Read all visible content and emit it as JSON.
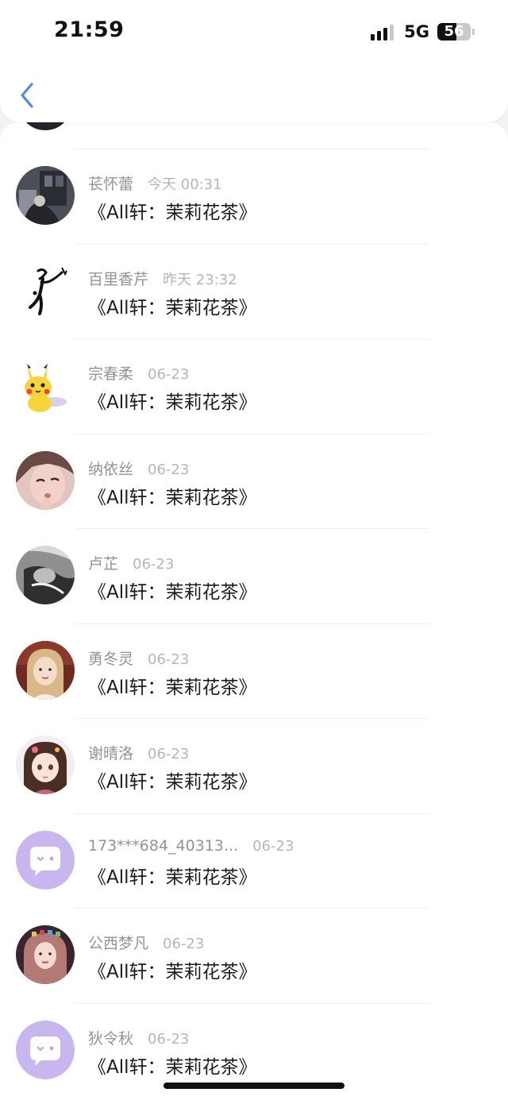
{
  "status_bar": {
    "time": "21:59",
    "network": "5G",
    "battery": "56",
    "battery_level_percent": 56,
    "signal_bars": 3
  },
  "nav": {
    "back_icon": "chevron-left-icon"
  },
  "colors": {
    "accent": "#4a90e2",
    "name_text": "#909399",
    "date_text": "#b4b6bb",
    "message_text": "#1c1c1e"
  },
  "comments": [
    {
      "name": "苌怀蕾",
      "date": "今天 00:31",
      "message": "《All轩：茉莉花茶》",
      "avatar": "photo-dark-room"
    },
    {
      "name": "百里香芹",
      "date": "昨天 23:32",
      "message": "《All轩：茉莉花茶》",
      "avatar": "stick-figure-sketch"
    },
    {
      "name": "宗春柔",
      "date": "06-23",
      "message": "《All轩：茉莉花茶》",
      "avatar": "pikachu"
    },
    {
      "name": "纳依丝",
      "date": "06-23",
      "message": "《All轩：茉莉花茶》",
      "avatar": "photo-selfie"
    },
    {
      "name": "卢芷",
      "date": "06-23",
      "message": "《All轩：茉莉花茶》",
      "avatar": "photo-monochrome"
    },
    {
      "name": "勇冬灵",
      "date": "06-23",
      "message": "《All轩：茉莉花茶》",
      "avatar": "photo-portrait"
    },
    {
      "name": "谢晴洛",
      "date": "06-23",
      "message": "《All轩：茉莉花茶》",
      "avatar": "anime-girl"
    },
    {
      "name": "173***684_40313...",
      "date": "06-23",
      "message": "《All轩：茉莉花茶》",
      "avatar": "default-chat-icon"
    },
    {
      "name": "公西梦凡",
      "date": "06-23",
      "message": "《All轩：茉莉花茶》",
      "avatar": "photo-portrait-pink"
    },
    {
      "name": "狄令秋",
      "date": "06-23",
      "message": "《All轩：茉莉花茶》",
      "avatar": "default-chat-icon"
    }
  ]
}
